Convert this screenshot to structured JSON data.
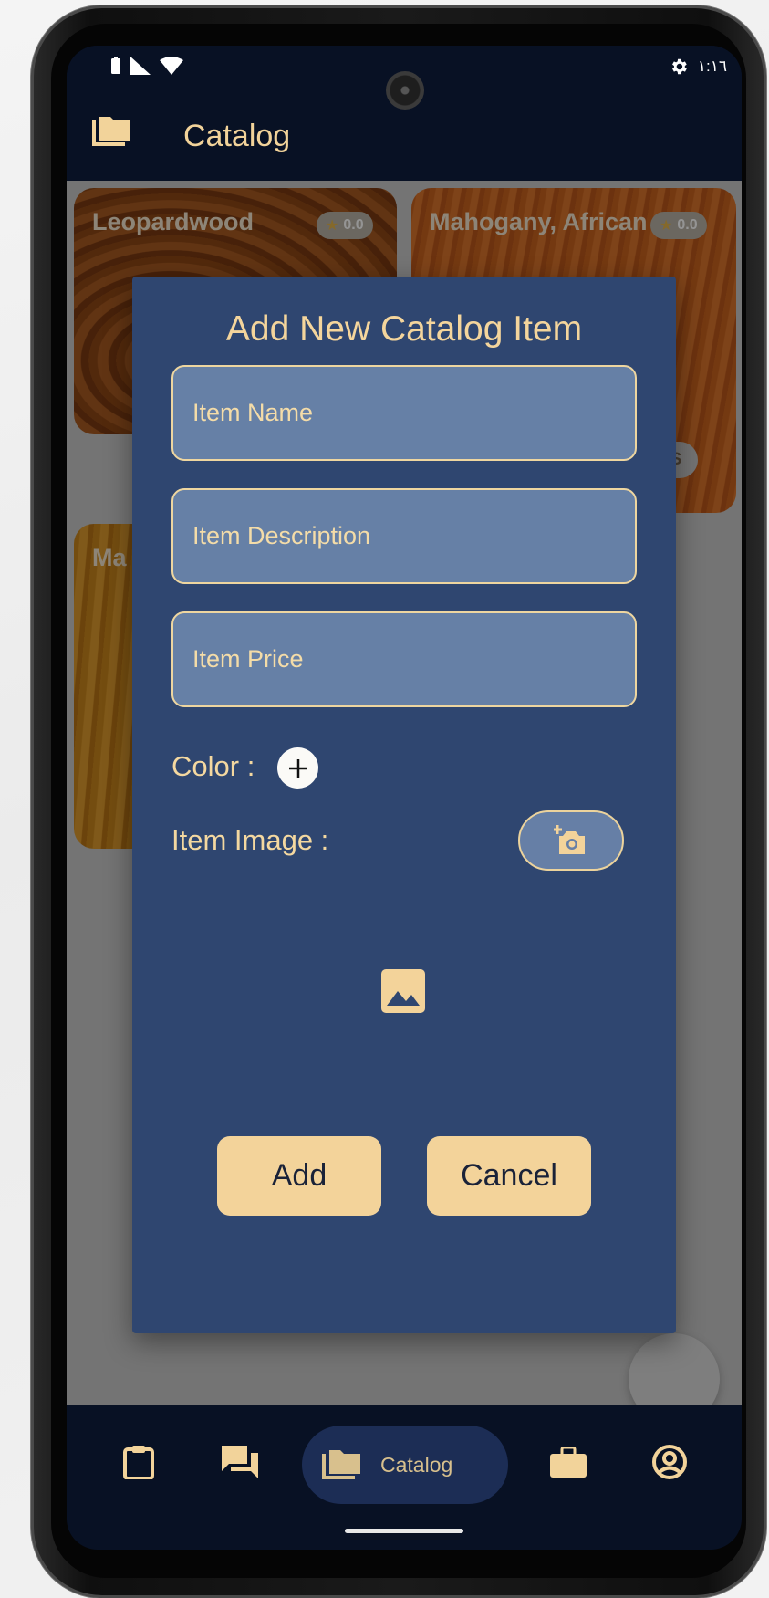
{
  "status_bar": {
    "time": "١:١٦"
  },
  "app_bar": {
    "title": "Catalog"
  },
  "catalog": {
    "cards": [
      {
        "name": "Leopardwood",
        "rating": "0.0"
      },
      {
        "name": "Mahogany, African",
        "rating": "0.0"
      },
      {
        "name": "Ma"
      }
    ],
    "details_fragment": "LS"
  },
  "dialog": {
    "title": "Add New Catalog Item",
    "fields": {
      "name_placeholder": "Item Name",
      "description_placeholder": "Item Description",
      "price_placeholder": "Item Price"
    },
    "color_label": "Color :",
    "image_label": "Item Image :",
    "add_label": "Add",
    "cancel_label": "Cancel"
  },
  "bottom_nav": {
    "items": [
      {
        "icon": "clipboard-icon"
      },
      {
        "icon": "chat-icon"
      },
      {
        "icon": "folder-icon",
        "label": "Catalog",
        "active": true
      },
      {
        "icon": "briefcase-icon"
      },
      {
        "icon": "account-circle-icon"
      }
    ]
  },
  "colors": {
    "accent": "#f3d39a",
    "dialog_bg": "#2f4670",
    "field_bg": "#6680a6",
    "app_bar_bg": "#081124"
  }
}
